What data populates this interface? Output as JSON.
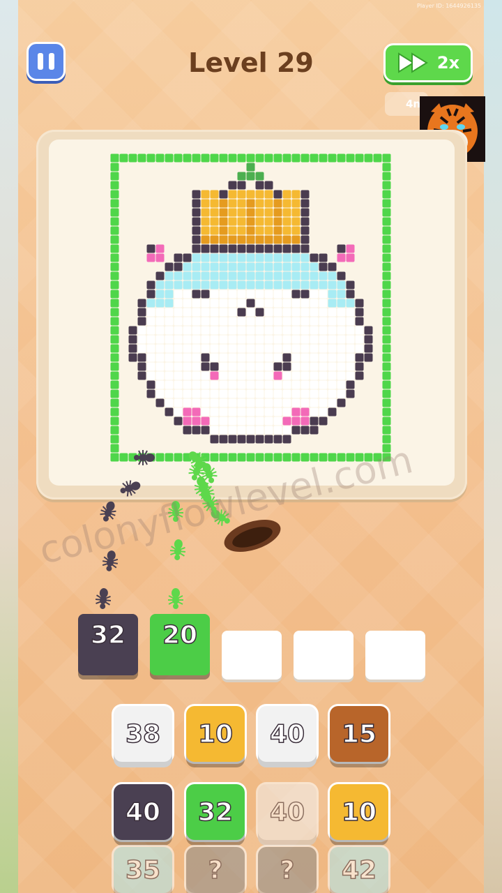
{
  "header": {
    "level_label": "Level 29",
    "speed_label": "2x",
    "status_tag": "4n",
    "player_id": "Player ID: 1644926135"
  },
  "watermark": "colonyflowlevel.com",
  "queue": [
    {
      "value": "32",
      "color": "#4a4052"
    },
    {
      "value": "20",
      "color": "#4ccd47"
    },
    {
      "value": "",
      "color": "empty"
    },
    {
      "value": "",
      "color": "empty"
    },
    {
      "value": "",
      "color": "empty"
    }
  ],
  "grid": {
    "row1": [
      {
        "value": "38",
        "color": "#f2f2f2",
        "dim": false
      },
      {
        "value": "10",
        "color": "#f5b932",
        "dim": false
      },
      {
        "value": "40",
        "color": "#f2f2f2",
        "dim": false
      },
      {
        "value": "15",
        "color": "#b8652a",
        "dim": false
      }
    ],
    "row2": [
      {
        "value": "40",
        "color": "#4a4052",
        "dim": false
      },
      {
        "value": "32",
        "color": "#4ccd47",
        "dim": false
      },
      {
        "value": "40",
        "color": "#f2f2f2",
        "dim": true
      },
      {
        "value": "10",
        "color": "#f5b932",
        "dim": false
      }
    ],
    "row3": [
      {
        "value": "35",
        "color": "#aeeaf2",
        "dim": true
      },
      {
        "value": "?",
        "color": "#8c8c8c",
        "dim": true
      },
      {
        "value": "?",
        "color": "#8c8c8c",
        "dim": true
      },
      {
        "value": "42",
        "color": "#aeeaf2",
        "dim": true
      }
    ]
  },
  "colors": {
    "frame_green": "#4fd64a",
    "outline": "#4a3c50",
    "crown": "#f5b932",
    "crown_band": "#e59b1f",
    "face_blue": "#a8ecf4",
    "face_white": "#ffffff",
    "cheek_pink": "#f36ab8",
    "stem_green": "#4caf50"
  },
  "icons": [
    "pause-icon",
    "fast-forward-icon",
    "tiger-avatar-icon",
    "ant-icon",
    "anthill-hole-icon"
  ]
}
